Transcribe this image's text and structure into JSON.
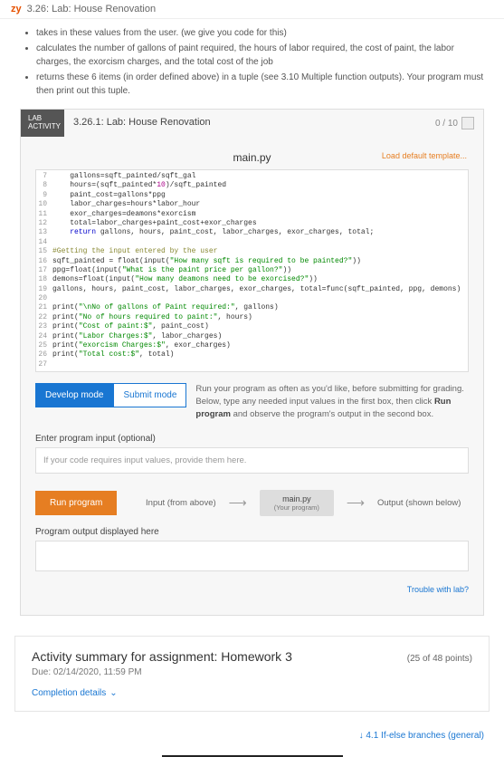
{
  "header": {
    "brand_prefix": "zy",
    "breadcrumb": "3.26: Lab: House Renovation"
  },
  "description": {
    "bullets": [
      "takes in these values from the user. (we give you code for this)",
      "calculates the number of gallons of paint required, the hours of labor required, the cost of paint, the labor charges, the exorcism charges, and the total cost of the job",
      "returns these 6 items (in order defined above) in a tuple (see 3.10 Multiple function outputs). Your program must then print out this tuple."
    ]
  },
  "activity": {
    "tag_line1": "LAB",
    "tag_line2": "ACTIVITY",
    "title": "3.26.1: Lab: House Renovation",
    "score": "0 / 10"
  },
  "editor": {
    "filename": "main.py",
    "load_template": "Load default template...",
    "lines": [
      {
        "n": "7",
        "html": "    gallons=sqft_painted/sqft_gal"
      },
      {
        "n": "8",
        "html": "    hours=(sqft_painted*<span class='c-num'>10</span>)/sqft_painted"
      },
      {
        "n": "9",
        "html": "    paint_cost=gallons*ppg"
      },
      {
        "n": "10",
        "html": "    labor_charges=hours*labor_hour"
      },
      {
        "n": "11",
        "html": "    exor_charges=deamons*exorcism"
      },
      {
        "n": "12",
        "html": "    total=labor_charges+paint_cost+exor_charges"
      },
      {
        "n": "13",
        "html": "    <span class='c-kw'>return</span> gallons, hours, paint_cost, labor_charges, exor_charges, total;"
      },
      {
        "n": "14",
        "html": ""
      },
      {
        "n": "15",
        "html": "<span class='c-cmt'>#Getting the input entered by the user</span>"
      },
      {
        "n": "16",
        "html": "sqft_painted = float(input(<span class='c-str'>\"How many sqft is required to be painted?\"</span>))"
      },
      {
        "n": "17",
        "html": "ppg=float(input(<span class='c-str'>\"What is the paint price per gallon?\"</span>))"
      },
      {
        "n": "18",
        "html": "demons=float(input(<span class='c-str'>\"How many deamons need to be exorcised?\"</span>))"
      },
      {
        "n": "19",
        "html": "gallons, hours, paint_cost, labor_charges, exor_charges, total=func(sqft_painted, ppg, demons)"
      },
      {
        "n": "20",
        "html": ""
      },
      {
        "n": "21",
        "html": "print(<span class='c-str'>\"\\nNo of gallons of Paint required:\"</span>, gallons)"
      },
      {
        "n": "22",
        "html": "print(<span class='c-str'>\"No of hours required to paint:\"</span>, hours)"
      },
      {
        "n": "23",
        "html": "print(<span class='c-str'>\"Cost of paint:$\"</span>, paint_cost)"
      },
      {
        "n": "24",
        "html": "print(<span class='c-str'>\"Labor Charges:$\"</span>, labor_charges)"
      },
      {
        "n": "25",
        "html": "print(<span class='c-str'>\"exorcism Charges:$\"</span>, exor_charges)"
      },
      {
        "n": "26",
        "html": "print(<span class='c-str'>\"Total cost:$\"</span>, total)"
      },
      {
        "n": "27",
        "html": ""
      }
    ]
  },
  "modes": {
    "develop": "Develop mode",
    "submit": "Submit mode",
    "desc_before": "Run your program as often as you'd like, before submitting for grading. Below, type any needed input values in the first box, then click ",
    "desc_bold": "Run program",
    "desc_after": " and observe the program's output in the second box."
  },
  "input": {
    "label": "Enter program input (optional)",
    "placeholder": "If your code requires input values, provide them here."
  },
  "run": {
    "button": "Run program",
    "input_label": "Input (from above)",
    "file": "main.py",
    "file_sub": "(Your program)",
    "output_label": "Output (shown below)"
  },
  "output": {
    "label": "Program output displayed here"
  },
  "trouble": "Trouble with lab?",
  "summary": {
    "title": "Activity summary for assignment: Homework 3",
    "points": "(25 of 48 points)",
    "due": "Due: 02/14/2020, 11:59 PM",
    "completion": "Completion details"
  },
  "footer": {
    "next": "↓ 4.1 If-else branches (general)"
  }
}
